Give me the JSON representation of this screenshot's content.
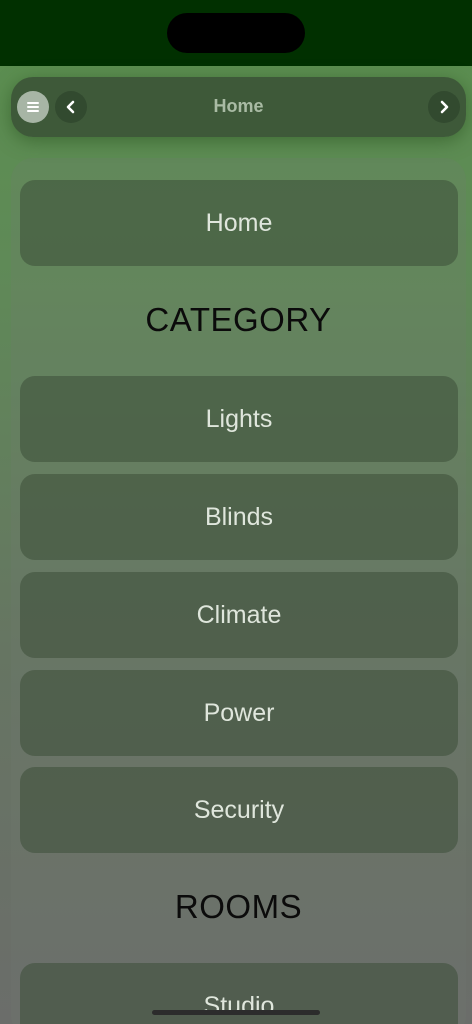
{
  "header": {
    "title": "Home",
    "menu_icon": "hamburger-icon",
    "back_icon": "chevron-left-icon",
    "forward_icon": "chevron-right-icon"
  },
  "menu": {
    "home_label": "Home",
    "category_heading": "CATEGORY",
    "categories": [
      {
        "label": "Lights"
      },
      {
        "label": "Blinds"
      },
      {
        "label": "Climate"
      },
      {
        "label": "Power"
      },
      {
        "label": "Security"
      }
    ],
    "rooms_heading": "ROOMS",
    "rooms": [
      {
        "label": "Studio"
      }
    ]
  },
  "colors": {
    "status_bar": "#013000",
    "header_bg": "#3c5537",
    "title_text": "#a9bba4",
    "item_text": "#dfe6dc",
    "heading_text": "#0b0b0b"
  }
}
